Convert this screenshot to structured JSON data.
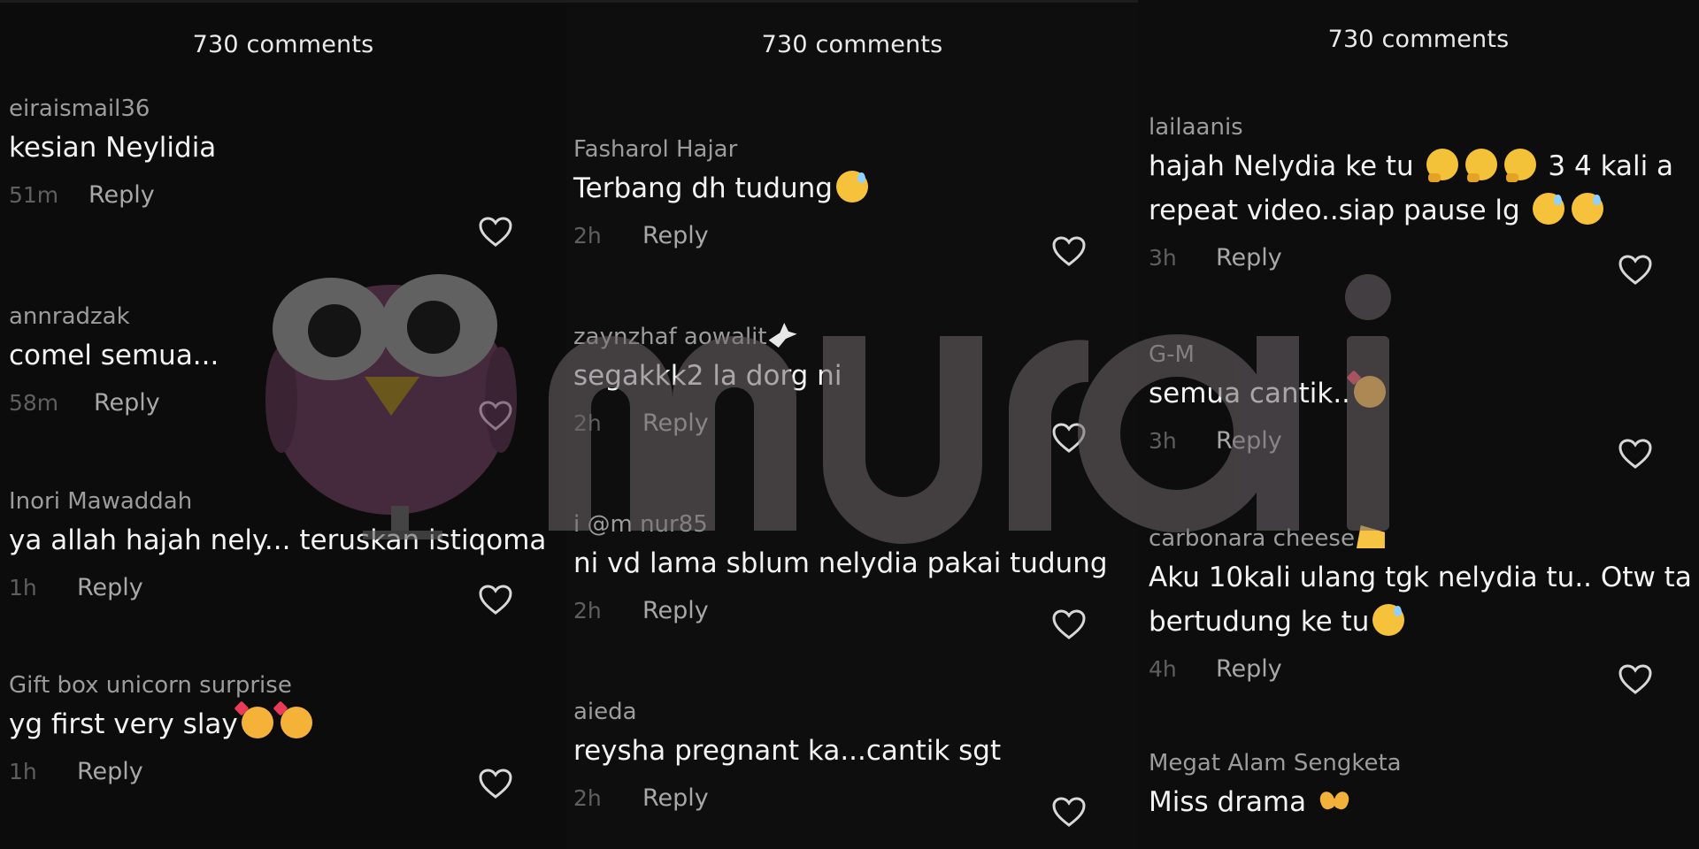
{
  "panels": [
    {
      "header": "730 comments",
      "comments": [
        {
          "user": "eiraismail36",
          "text": "kesian Neylidia",
          "time": "51m",
          "reply": "Reply",
          "emoji": []
        },
        {
          "user": "annradzak",
          "text": "comel semua...",
          "time": "58m",
          "reply": "Reply",
          "emoji": []
        },
        {
          "user": "Inori Mawaddah",
          "text": "ya allah hajah nely... teruskan istiqoma",
          "time": "1h",
          "reply": "Reply",
          "emoji": []
        },
        {
          "user": "Gift box unicorn surprise",
          "text": "yg first very slay",
          "time": "1h",
          "reply": "Reply",
          "emoji": [
            "smiling-face-with-hearts",
            "smiling-face-with-hearts"
          ]
        }
      ]
    },
    {
      "header": "730 comments",
      "comments": [
        {
          "user": "Fasharol Hajar",
          "text": "Terbang dh tudung",
          "time": "2h",
          "reply": "Reply",
          "emoji": [
            "grinning-sweat"
          ]
        },
        {
          "user": "zaynzhaf aowalit",
          "text": "segakkk2 la dorg ni",
          "time": "2h",
          "reply": "Reply",
          "emoji": []
        },
        {
          "user": "i @m nur85",
          "text": "ni vd lama sblum nelydia pakai tudung",
          "time": "2h",
          "reply": "Reply",
          "emoji": []
        },
        {
          "user": "aieda",
          "text": "reysha pregnant ka...cantik sgt",
          "time": "2h",
          "reply": "Reply",
          "emoji": []
        }
      ]
    },
    {
      "header": "730 comments",
      "comments": [
        {
          "user": "lailaanis",
          "text": "hajah Nelydia ke tu",
          "text_mid": "3 4 kali a",
          "text_line2": "repeat video..siap pause lg",
          "time": "3h",
          "reply": "Reply",
          "emoji": [
            "thinking",
            "thinking",
            "thinking",
            "grinning-sweat",
            "grinning-sweat"
          ]
        },
        {
          "user": "G-M",
          "text": "semua cantik..",
          "time": "3h",
          "reply": "Reply",
          "emoji": [
            "smiling-face-with-hearts"
          ]
        },
        {
          "user": "carbonara cheese",
          "text": "Aku 10kali ulang tgk nelydia tu.. Otw ta",
          "text_line2": "bertudung ke tu",
          "time": "4h",
          "reply": "Reply",
          "emoji": [
            "grinning-sweat"
          ]
        },
        {
          "user": "Megat Alam Sengketa",
          "text": "Miss drama",
          "emoji": [
            "heart-hands"
          ]
        }
      ]
    }
  ],
  "watermark": {
    "brand": "murai",
    "mascot": "owl",
    "color": "#7a6f74",
    "mascot_color": "#8a5a78"
  },
  "colors": {
    "background": "#0c0c0c",
    "username": "#9c9c9c",
    "text": "#f3f3f3",
    "time": "#5f5f5f",
    "reply": "#a8a8a8"
  }
}
